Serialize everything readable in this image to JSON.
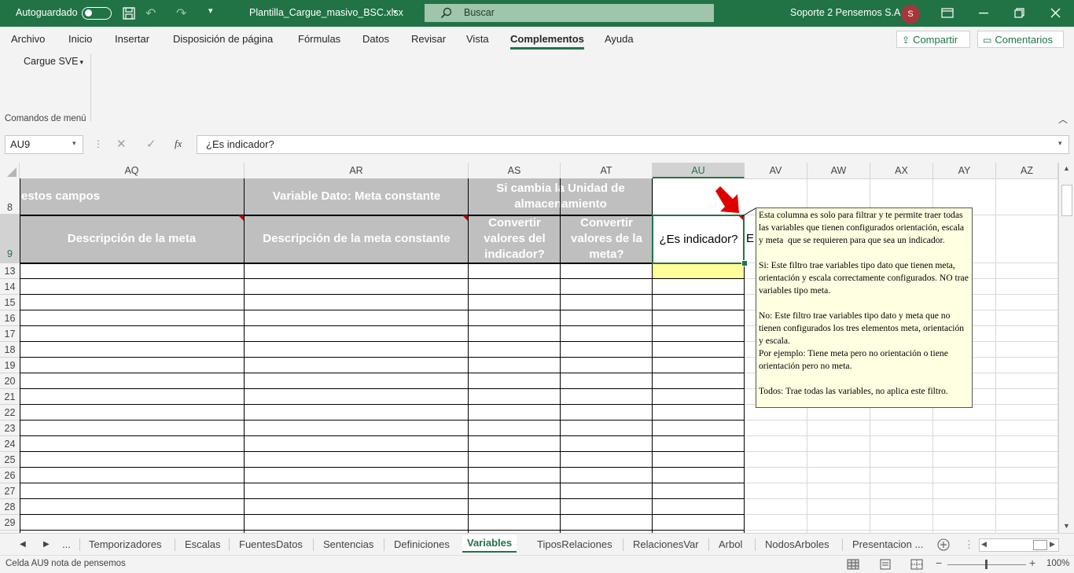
{
  "titlebar": {
    "autosave_label": "Autoguardado",
    "filename": "Plantilla_Cargue_masivo_BSC.xlsx",
    "search_placeholder": "Buscar",
    "user_name": "Soporte 2 Pensemos S.A.",
    "user_initial": "S"
  },
  "ribbon": {
    "tabs": [
      "Archivo",
      "Inicio",
      "Insertar",
      "Disposición de página",
      "Fórmulas",
      "Datos",
      "Revisar",
      "Vista",
      "Complementos",
      "Ayuda"
    ],
    "active_tab": "Complementos",
    "share_label": "Compartir",
    "comments_label": "Comentarios",
    "menu_item": "Cargue SVE",
    "group_label": "Comandos de menú"
  },
  "formula_bar": {
    "name_box": "AU9",
    "fx_label": "fx",
    "content": "¿Es indicador?"
  },
  "columns": [
    "AQ",
    "AR",
    "AS",
    "AT",
    "AU",
    "AV",
    "AW",
    "AX",
    "AY",
    "AZ"
  ],
  "selected_column": "AU",
  "rows": [
    "8",
    "9",
    "13",
    "14",
    "15",
    "16",
    "17",
    "18",
    "19",
    "20",
    "21",
    "22",
    "23",
    "24",
    "25",
    "26",
    "27",
    "28",
    "29"
  ],
  "cells": {
    "row8_aq": "estos campos",
    "row8_ar": "Variable Dato: Meta constante",
    "row8_as": "Si cambia la Unidad de almacenamiento",
    "row9_aq": "Descripción de la meta",
    "row9_ar": "Descripción de la meta constante",
    "row9_as": "Convertir valores del indicador?",
    "row9_at": "Convertir valores de la meta?",
    "row9_au": "¿Es indicador?",
    "row9_av_overflow": "E"
  },
  "comment": {
    "text": "Esta columna es solo para filtrar y te permite traer todas las variables que tienen configurados orientación, escala y meta  que se requieren para que sea un indicador.\n\nSi: Este filtro trae variables tipo dato que tienen meta, orientación y escala correctamente configurados. NO trae variables tipo meta.\n\nNo: Este filtro trae variables tipo dato y meta que no tienen configurados los tres elementos meta, orientación y escala.\nPor ejemplo: Tiene meta pero no orientación o tiene orientación pero no meta.\n\nTodos: Trae todas las variables, no aplica este filtro."
  },
  "sheet_tabs": {
    "ellipsis": "...",
    "tabs": [
      "Temporizadores",
      "Escalas",
      "FuentesDatos",
      "Sentencias",
      "Definiciones",
      "Variables",
      "TiposRelaciones",
      "RelacionesVar",
      "Arbol",
      "NodosArboles",
      "Presentacion ..."
    ],
    "active": "Variables"
  },
  "status": {
    "text": "Celda AU9 nota de pensemos",
    "zoom": "100%"
  },
  "colors": {
    "excel_green": "#217346",
    "header_fill": "#bfbfbf",
    "comment_fill": "#ffffe1",
    "highlight_yellow": "#ffff99",
    "arrow_red": "#e00000"
  }
}
